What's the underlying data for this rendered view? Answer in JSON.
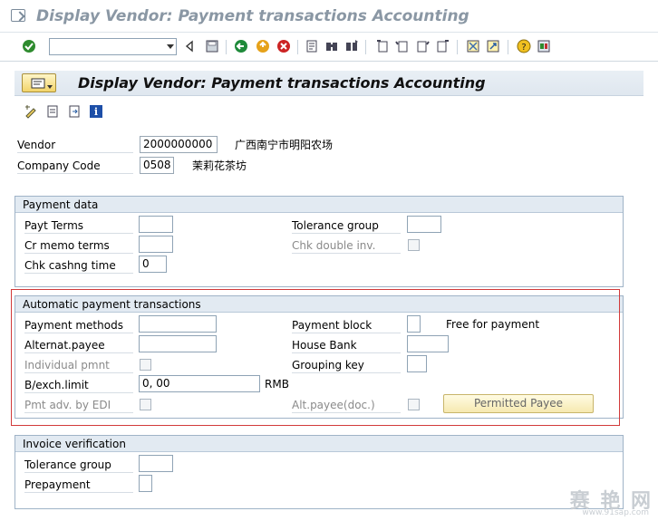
{
  "window": {
    "title": "Display Vendor: Payment transactions Accounting"
  },
  "toolbar": {
    "command_field_value": "",
    "icons": [
      "enter-check-icon",
      "back-arrow-icon",
      "save-icon",
      "back-icon",
      "exit-icon",
      "cancel-icon",
      "print-icon",
      "find-icon",
      "find-next-icon",
      "first-page-icon",
      "previous-page-icon",
      "next-page-icon",
      "last-page-icon",
      "create-session-icon",
      "shortcut-icon",
      "help-icon",
      "customize-layout-icon"
    ]
  },
  "screen": {
    "title": "Display Vendor: Payment transactions Accounting",
    "app_icons": [
      "display-change-icon",
      "other-vendor-icon",
      "next-screen-icon",
      "info-icon"
    ]
  },
  "header": {
    "vendor_label": "Vendor",
    "vendor_value": "2000000000",
    "vendor_name": "广西南宁市明阳农场",
    "company_code_label": "Company Code",
    "company_code_value": "0508",
    "company_name": "茉莉花茶坊"
  },
  "payment_data": {
    "title": "Payment data",
    "payt_terms_label": "Payt Terms",
    "payt_terms_value": "",
    "cr_memo_terms_label": "Cr memo terms",
    "cr_memo_terms_value": "",
    "chk_cashng_time_label": "Chk cashng time",
    "chk_cashng_time_value": "0",
    "tolerance_group_label": "Tolerance group",
    "tolerance_group_value": "",
    "chk_double_inv_label": "Chk double inv."
  },
  "automatic_payment": {
    "title": "Automatic payment transactions",
    "payment_methods_label": "Payment methods",
    "payment_methods_value": "",
    "alternat_payee_label": "Alternat.payee",
    "alternat_payee_value": "",
    "individual_pmnt_label": "Individual pmnt",
    "bexch_limit_label": "B/exch.limit",
    "bexch_limit_value": "0, 00",
    "bexch_currency": "RMB",
    "pmt_adv_edi_label": "Pmt adv. by EDI",
    "payment_block_label": "Payment block",
    "payment_block_value": "",
    "payment_block_text": "Free for payment",
    "house_bank_label": "House Bank",
    "house_bank_value": "",
    "grouping_key_label": "Grouping key",
    "grouping_key_value": "",
    "alt_payee_doc_label": "Alt.payee(doc.)",
    "permitted_payee_button": "Permitted Payee"
  },
  "invoice_verification": {
    "title": "Invoice verification",
    "tolerance_group_label": "Tolerance group",
    "tolerance_group_value": "",
    "prepayment_label": "Prepayment",
    "prepayment_value": ""
  },
  "watermark": {
    "main": "赛 艳 网",
    "sub": "www.91sap.com"
  },
  "colors": {
    "accent_header": "#dfe7ef",
    "group_header": "#e2eaf2",
    "highlight_border": "#d23a3a",
    "button_yellow": "#f2d46a"
  }
}
